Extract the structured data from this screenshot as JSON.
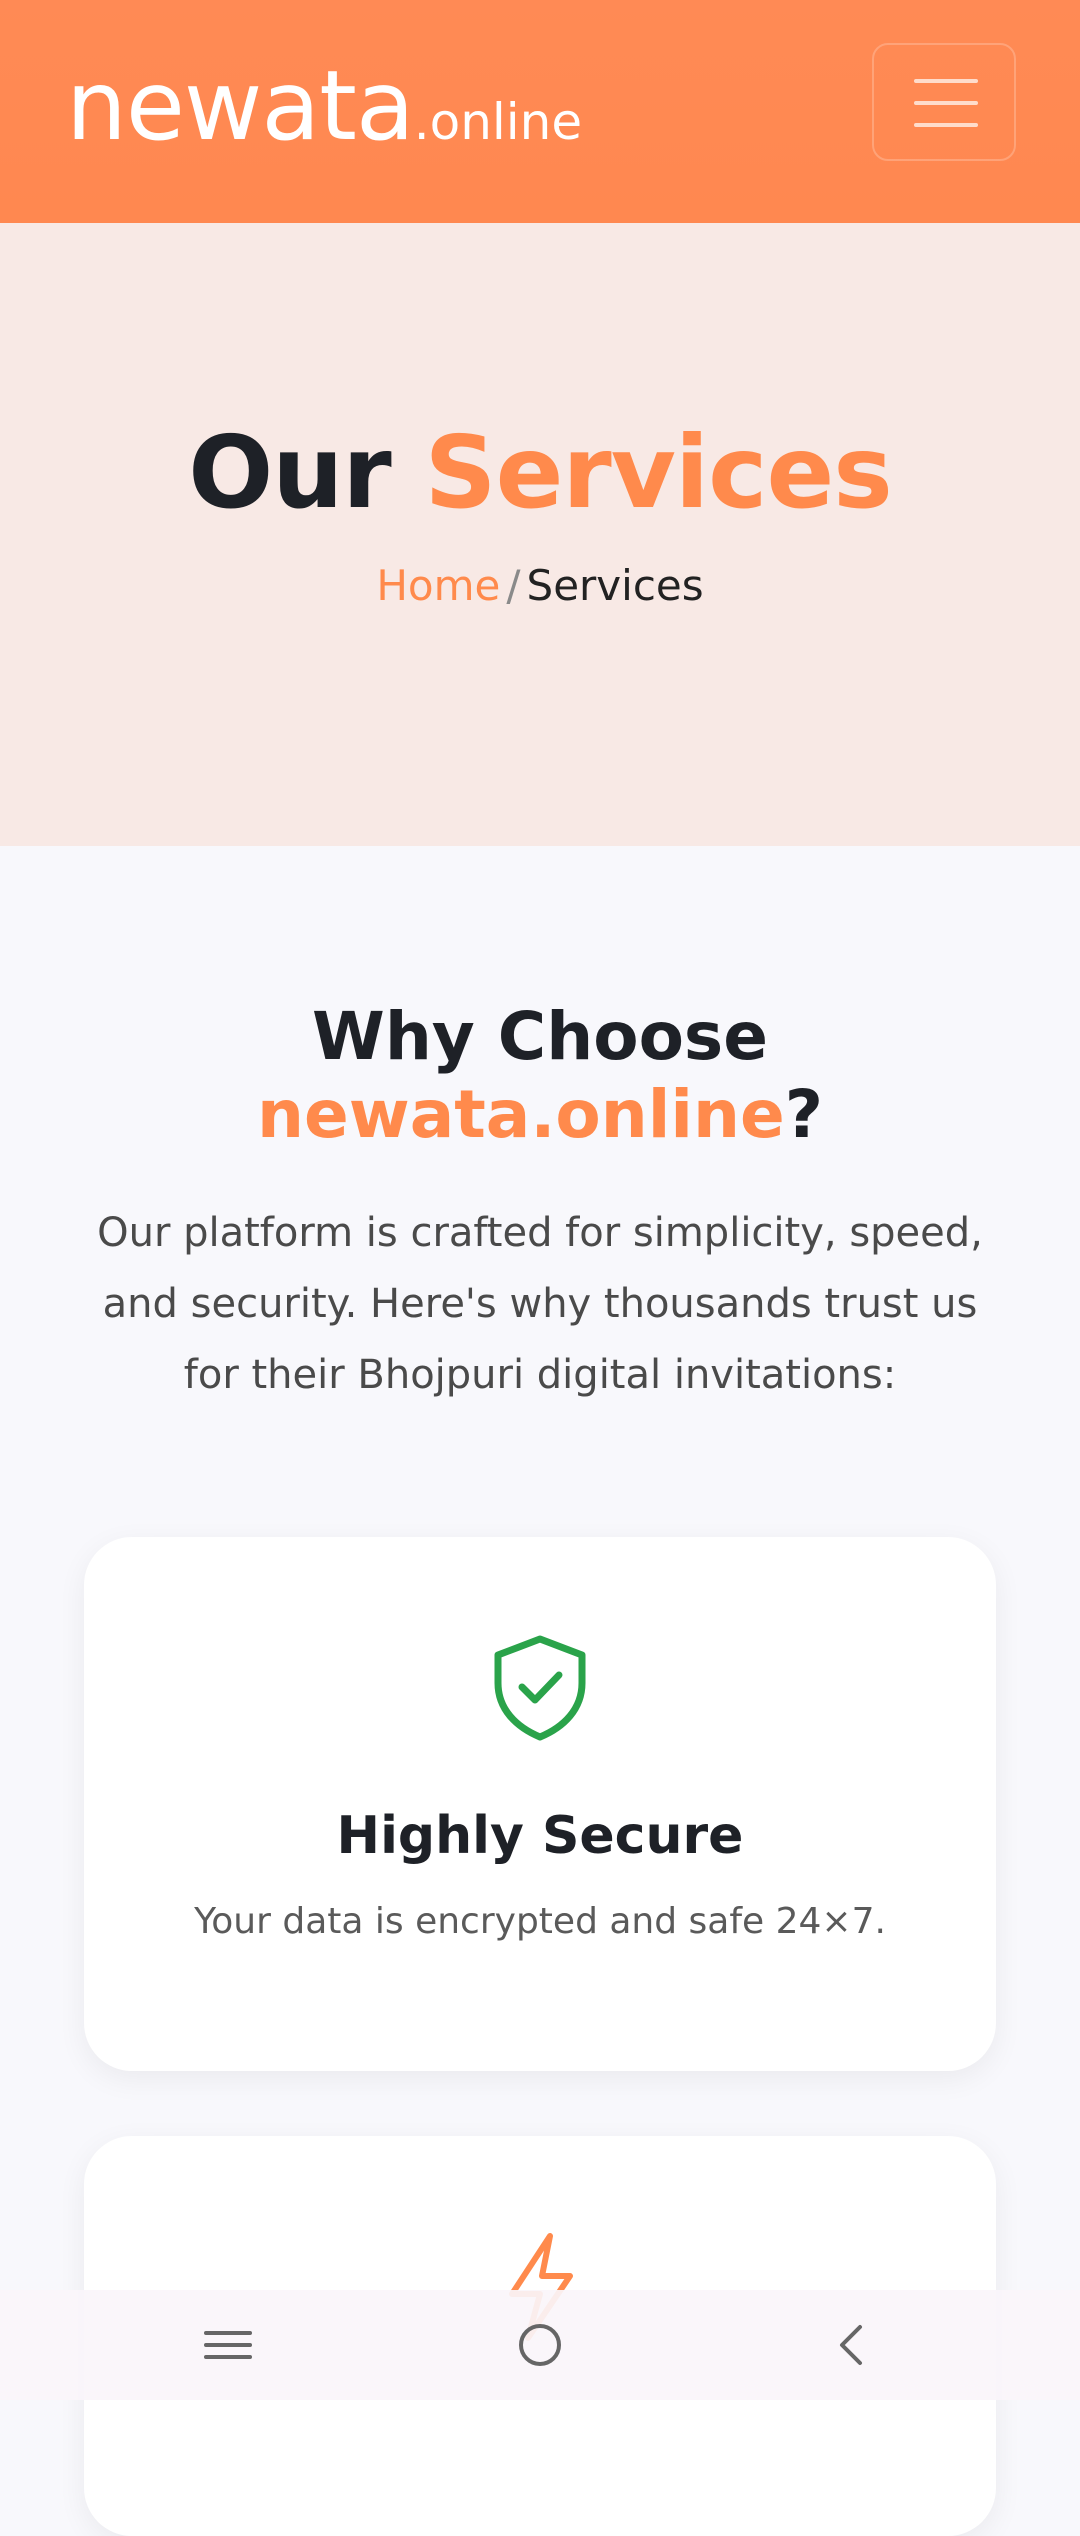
{
  "header": {
    "logo_main": "newata",
    "logo_suffix": ".online",
    "menu_icon": "hamburger-menu-icon"
  },
  "hero": {
    "title_part1": "Our",
    "title_part2": "Services",
    "breadcrumb": {
      "home": "Home",
      "separator": "/",
      "current": "Services"
    }
  },
  "why": {
    "title_line1": "Why Choose",
    "title_accent": "newata.online",
    "title_end": "?",
    "description": "Our platform is crafted for simplicity, speed, and security. Here's why thousands trust us for their Bhojpuri digital invitations:"
  },
  "features": [
    {
      "icon": "shield-check-icon",
      "title": "Highly Secure",
      "text": "Your data is encrypted and safe 24×7."
    },
    {
      "icon": "lightning-icon"
    }
  ],
  "navbar": {
    "menu_icon": "recent-apps-icon",
    "home_icon": "home-circle-icon",
    "back_icon": "back-chevron-icon"
  },
  "colors": {
    "brand_orange": "#ff8a4c",
    "header_bg": "#ff8850",
    "hero_bg": "#f8e9e5",
    "page_bg": "#f8f8fc",
    "secure_green": "#2aa34a"
  }
}
